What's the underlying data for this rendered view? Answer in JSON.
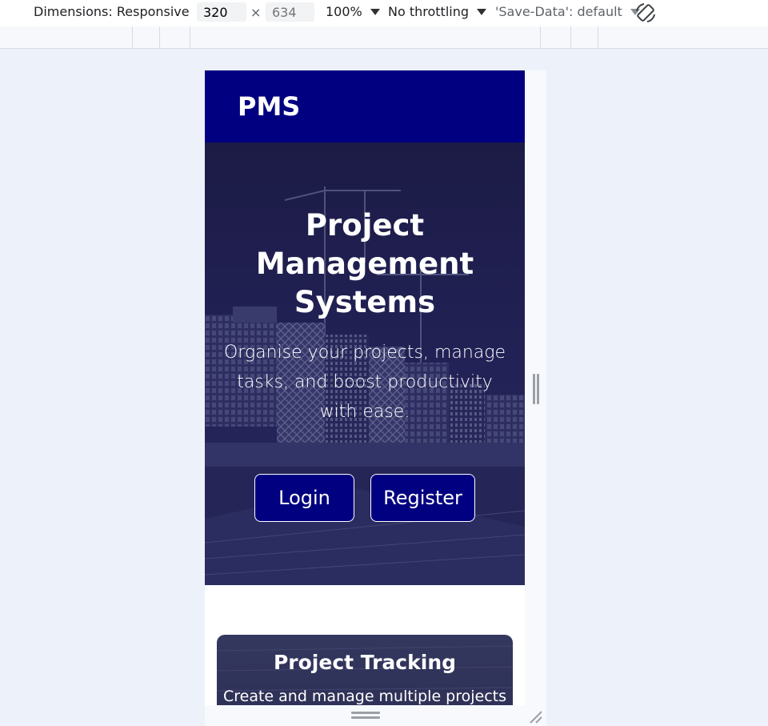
{
  "devtools": {
    "dimensions_label": "Dimensions: Responsive",
    "width_value": "320",
    "times": "×",
    "height_placeholder": "634",
    "zoom": "100%",
    "throttling": "No throttling",
    "save_data": "'Save-Data': default"
  },
  "page": {
    "brand": "PMS",
    "hero": {
      "title": "Project Management Systems",
      "subtitle": "Organise your projects, manage tasks, and boost productivity with ease.",
      "login_label": "Login",
      "register_label": "Register"
    },
    "feature_card": {
      "title": "Project Tracking",
      "text": "Create and manage multiple projects"
    }
  },
  "colors": {
    "navy": "#000080",
    "hero_overlay": "#242356",
    "page_bg": "#edf1fa"
  }
}
